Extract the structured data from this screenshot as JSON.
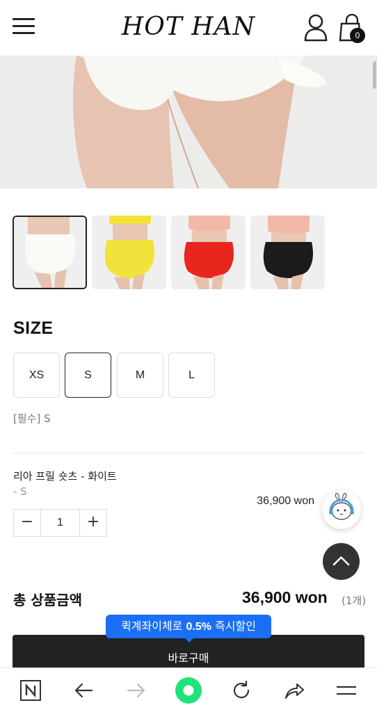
{
  "header": {
    "brand": "HOT HAN",
    "cart_count": "0"
  },
  "gallery": {
    "thumbnails": [
      {
        "color_name": "white",
        "color": "#f5f5f0"
      },
      {
        "color_name": "yellow",
        "color": "#f2e23c"
      },
      {
        "color_name": "red",
        "color": "#e8261e"
      },
      {
        "color_name": "black",
        "color": "#1b1b1b"
      }
    ],
    "selected_index": 0
  },
  "size": {
    "title": "SIZE",
    "options": [
      "XS",
      "S",
      "M",
      "L"
    ],
    "selected": "S",
    "required_text": "[필수] S"
  },
  "line_item": {
    "name": "리아 프릴 숏츠 - 화이트",
    "option": "- S",
    "price": "36,900 won",
    "quantity": "1",
    "minus": "−",
    "plus": "+"
  },
  "total": {
    "label": "총 상품금액",
    "price": "36,900 won",
    "count": "(1개)"
  },
  "promo": {
    "before": "퀵계좌이체로 ",
    "rate": "0.5%",
    "after": " 즉시할인"
  },
  "buy_button": "바로구매",
  "colors": {
    "accent_blue": "#1a6ff5",
    "dark": "#222222"
  },
  "icons": [
    "menu-icon",
    "user-icon",
    "shopping-bag-icon",
    "chat-bot-icon",
    "arrow-up-icon",
    "naver-n-icon",
    "back-arrow-icon",
    "forward-arrow-icon",
    "green-circle-icon",
    "refresh-icon",
    "share-icon",
    "browser-menu-icon"
  ]
}
